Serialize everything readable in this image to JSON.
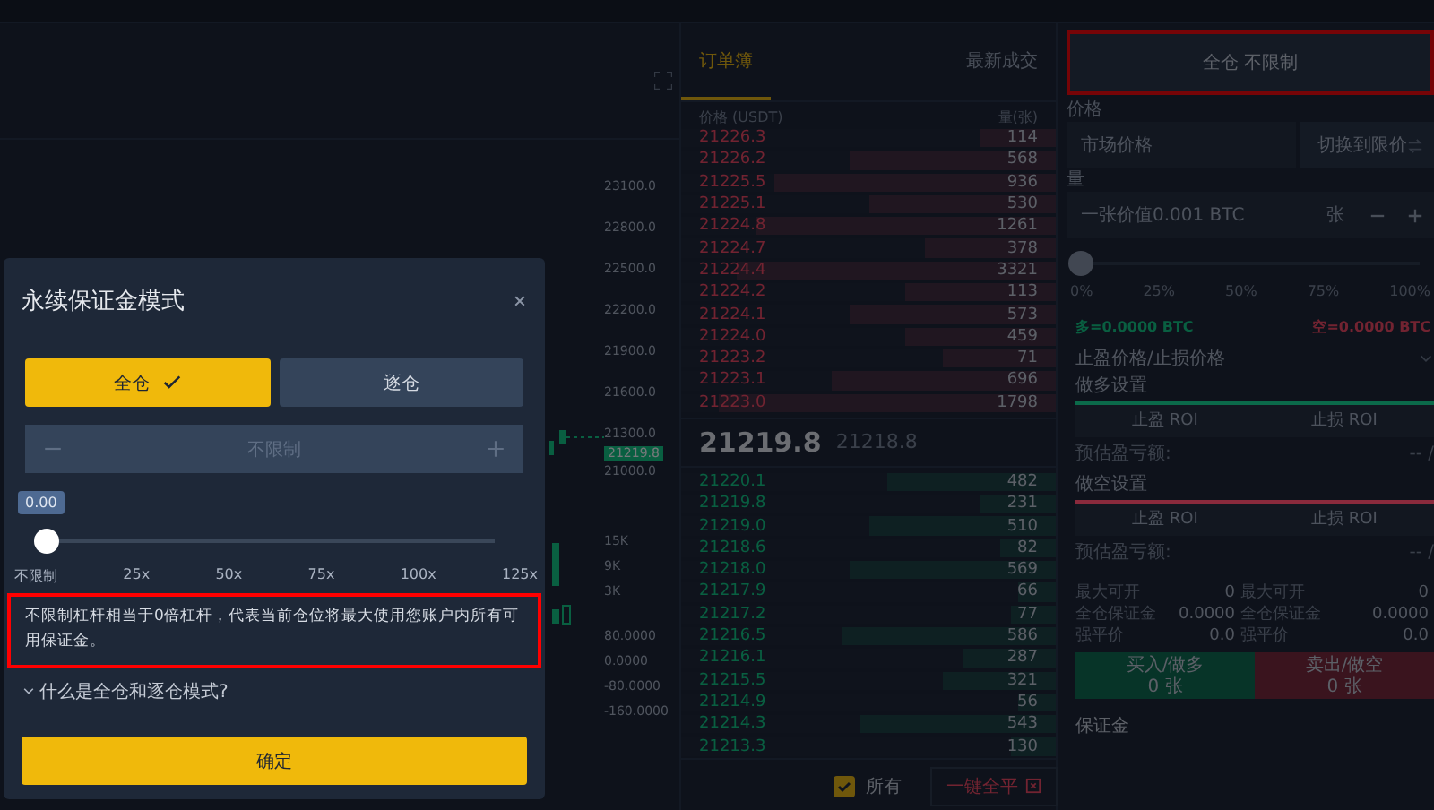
{
  "chart": {
    "price_axis": [
      "23100.0",
      "22800.0",
      "22500.0",
      "22200.0",
      "21900.0",
      "21600.0",
      "21300.0"
    ],
    "last_price_tag": "21219.8",
    "price_axis_low": "21000.0",
    "volume_axis": [
      "15K",
      "9K",
      "3K"
    ],
    "indicator_axis": [
      "80.0000",
      "0.0000",
      "-80.0000",
      "-160.0000"
    ]
  },
  "order_book": {
    "tabs": [
      {
        "label": "订单簿",
        "selected": true
      },
      {
        "label": "最新成交",
        "selected": false
      }
    ],
    "columns": [
      "价格 (USDT)",
      "量(张)"
    ],
    "asks": [
      {
        "price": "21226.3",
        "qty": "114",
        "level": 0.2
      },
      {
        "price": "21226.2",
        "qty": "568",
        "level": 0.55
      },
      {
        "price": "21225.5",
        "qty": "936",
        "level": 0.75
      },
      {
        "price": "21225.1",
        "qty": "530",
        "level": 0.5
      },
      {
        "price": "21224.8",
        "qty": "1261",
        "level": 0.8
      },
      {
        "price": "21224.7",
        "qty": "378",
        "level": 0.35
      },
      {
        "price": "21224.4",
        "qty": "3321",
        "level": 0.85
      },
      {
        "price": "21224.2",
        "qty": "113",
        "level": 0.4
      },
      {
        "price": "21224.1",
        "qty": "573",
        "level": 0.55
      },
      {
        "price": "21224.0",
        "qty": "459",
        "level": 0.4
      },
      {
        "price": "21223.2",
        "qty": "71",
        "level": 0.3
      },
      {
        "price": "21223.1",
        "qty": "696",
        "level": 0.6
      },
      {
        "price": "21223.0",
        "qty": "1798",
        "level": 0.9
      }
    ],
    "last_price": "21219.8",
    "mark_price": "21218.8",
    "bids": [
      {
        "price": "21220.1",
        "qty": "482",
        "level": 0.45
      },
      {
        "price": "21219.8",
        "qty": "231",
        "level": 0.2
      },
      {
        "price": "21219.0",
        "qty": "510",
        "level": 0.5
      },
      {
        "price": "21218.6",
        "qty": "82",
        "level": 0.15
      },
      {
        "price": "21218.0",
        "qty": "569",
        "level": 0.55
      },
      {
        "price": "21217.9",
        "qty": "66",
        "level": 0.1
      },
      {
        "price": "21217.2",
        "qty": "77",
        "level": 0.12
      },
      {
        "price": "21216.5",
        "qty": "586",
        "level": 0.57
      },
      {
        "price": "21216.1",
        "qty": "287",
        "level": 0.25
      },
      {
        "price": "21215.5",
        "qty": "321",
        "level": 0.3
      },
      {
        "price": "21214.9",
        "qty": "56",
        "level": 0.1
      },
      {
        "price": "21214.3",
        "qty": "543",
        "level": 0.52
      },
      {
        "price": "21213.3",
        "qty": "130",
        "level": 0.12
      }
    ],
    "show_all": {
      "label": "所有",
      "checked": true
    },
    "close_all_button": "一键全平"
  },
  "order_form": {
    "margin_mode_button": {
      "label": "全仓 不限制",
      "highlighted": true
    },
    "price_label": "价格",
    "price_field": {
      "placeholder": "市场价格"
    },
    "switch_button": "切换到限价",
    "qty_label": "量",
    "qty_field": {
      "placeholder": "一张价值0.001 BTC"
    },
    "qty_unit": "张",
    "slider": {
      "level": 0,
      "ticks": [
        "0%",
        "25%",
        "50%",
        "75%",
        "100%"
      ]
    },
    "long_amount": "多=0.0000 BTC",
    "short_amount": "空=0.0000 BTC",
    "tp_sl_label": "止盈价格/止损价格",
    "sections": [
      {
        "title": "做多设置",
        "color": "#0b6a4a",
        "fields": [
          {
            "placeholder": "止盈 ROI"
          },
          {
            "placeholder": "止损 ROI"
          }
        ],
        "estimate_label": "预估盈亏额:",
        "estimate_value": "-- /"
      },
      {
        "title": "做空设置",
        "color": "#8a2a3c",
        "fields": [
          {
            "placeholder": "止盈 ROI"
          },
          {
            "placeholder": "止损 ROI"
          }
        ],
        "estimate_label": "预估盈亏额:",
        "estimate_value": "-- /"
      }
    ],
    "stats": [
      [
        {
          "label": "最大可开",
          "value": "0"
        },
        {
          "label": "最大可开",
          "value": "0"
        }
      ],
      [
        {
          "label": "全仓保证金",
          "value": "0.0000"
        },
        {
          "label": "全仓保证金",
          "value": "0.0000"
        }
      ],
      [
        {
          "label": "强平价",
          "value": "0.0"
        },
        {
          "label": "强平价",
          "value": "0.0"
        }
      ]
    ],
    "buy_button": {
      "label": "买入/做多",
      "sub": "0 张"
    },
    "sell_button": {
      "label": "卖出/做空",
      "sub": "0 张"
    },
    "margin_label": "保证金"
  },
  "dialog": {
    "title": "永续保证金模式",
    "modes": [
      {
        "label": "全仓",
        "selected": true
      },
      {
        "label": "逐仓",
        "selected": false
      }
    ],
    "leverage_field": {
      "value": "不限制",
      "disabled": true
    },
    "slider": {
      "value": "0.00",
      "level": 0,
      "ticks": [
        "不限制",
        "25x",
        "50x",
        "75x",
        "100x",
        "125x"
      ]
    },
    "note": {
      "text": "不限制杠杆相当于0倍杠杆，代表当前仓位将最大使用您账户内所有可用保证金。",
      "highlighted": true
    },
    "help": {
      "label": "什么是全仓和逐仓模式?",
      "expanded": false
    },
    "confirm_button": "确定"
  }
}
